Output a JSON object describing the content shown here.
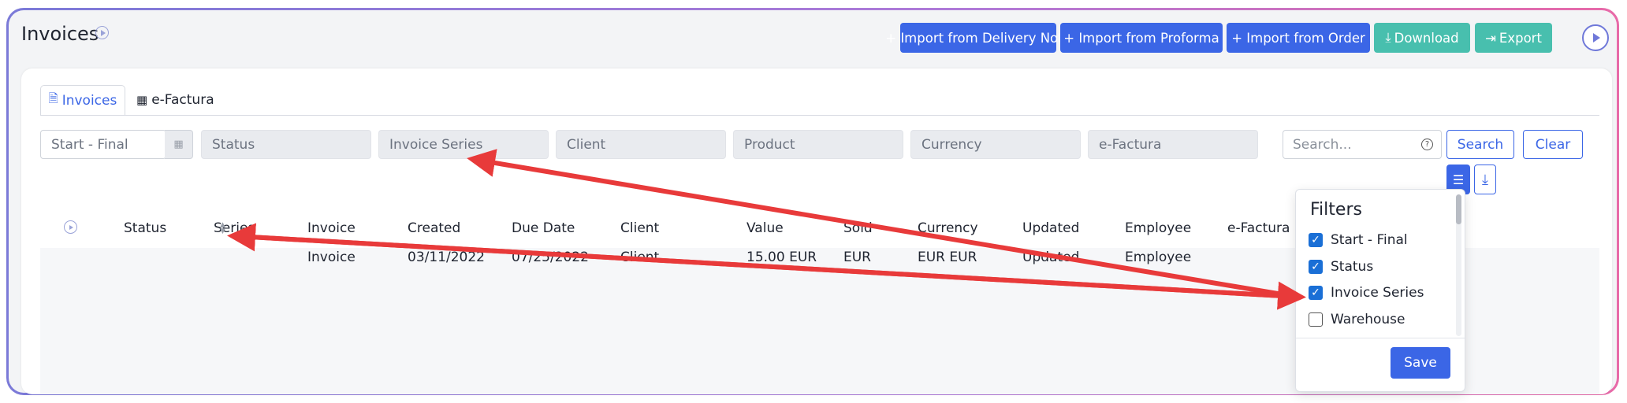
{
  "page": {
    "title": "Invoices"
  },
  "toolbar": {
    "import_delivery": "+ Import from Delivery Note",
    "import_proforma": "+ Import from Proforma",
    "import_order": "+ Import from Order",
    "download": "Download",
    "export": "Export"
  },
  "tabs": [
    {
      "label": "Invoices",
      "active": true
    },
    {
      "label": "e-Factura",
      "active": false
    }
  ],
  "filters": {
    "date_range": "Start - Final",
    "status": "Status",
    "invoice_series": "Invoice Series",
    "client": "Client",
    "product": "Product",
    "currency": "Currency",
    "e_factura": "e-Factura",
    "search_placeholder": "Search...",
    "search_button": "Search",
    "clear_button": "Clear"
  },
  "table": {
    "headers": [
      "Status",
      "Series",
      "Invoice",
      "Created",
      "Due Date",
      "Client",
      "Value",
      "Sold",
      "Currency",
      "Updated",
      "Employee",
      "e-Factura"
    ],
    "rows": [
      {
        "invoice": "Invoice",
        "created": "03/11/2022",
        "due_date": "07/25/2022",
        "client": "Client",
        "value": "15.00 EUR",
        "sold": "EUR",
        "currency": "EUR EUR",
        "updated": "Updated",
        "employee": "Employee"
      }
    ]
  },
  "filters_popup": {
    "title": "Filters",
    "options": [
      {
        "label": "Start - Final",
        "checked": true
      },
      {
        "label": "Status",
        "checked": true
      },
      {
        "label": "Invoice Series",
        "checked": true
      },
      {
        "label": "Warehouse",
        "checked": false
      }
    ],
    "save": "Save"
  },
  "colors": {
    "primary": "#3b66e6",
    "teal": "#48bfae",
    "annotation": "#e83a3a"
  }
}
